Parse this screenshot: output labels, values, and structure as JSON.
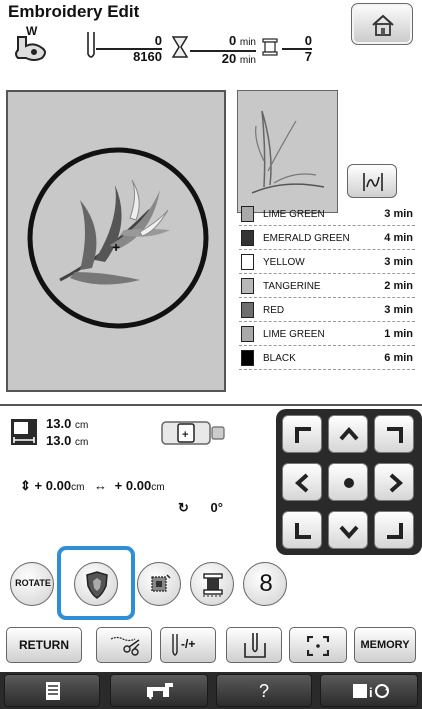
{
  "header": {
    "title": "Embroidery Edit",
    "home_icon": "home-icon",
    "presser_foot_label": "W",
    "stitch_counter": {
      "done": "0",
      "total": "8160"
    },
    "time_counter": {
      "done": "0",
      "done_unit": "min",
      "total": "20",
      "total_unit": "min"
    },
    "color_counter": {
      "done": "0",
      "total": "7"
    }
  },
  "preview": {
    "jump_icon": "needle-jump-icon"
  },
  "colors": [
    {
      "name": "LIME GREEN",
      "time": "3 min",
      "chip": "#a9a9a9"
    },
    {
      "name": "EMERALD GREEN",
      "time": "4 min",
      "chip": "#333333"
    },
    {
      "name": "YELLOW",
      "time": "3 min",
      "chip": "#ffffff"
    },
    {
      "name": "TANGERINE",
      "time": "2 min",
      "chip": "#b8b8b8"
    },
    {
      "name": "RED",
      "time": "3 min",
      "chip": "#6e6e6e"
    },
    {
      "name": "LIME GREEN",
      "time": "1 min",
      "chip": "#a9a9a9"
    },
    {
      "name": "BLACK",
      "time": "6 min",
      "chip": "#000000"
    }
  ],
  "size": {
    "width": "13.0",
    "height": "13.0",
    "unit": "cm"
  },
  "position": {
    "y_sign": "+",
    "y": "0.00",
    "y_unit": "cm",
    "x_sign": "+",
    "x": "0.00",
    "x_unit": "cm",
    "angle": "0°"
  },
  "tools": {
    "rotate_label": "ROTATE",
    "number_label": "8"
  },
  "bottom_buttons": {
    "return_label": "RETURN",
    "memory_label": "MEMORY",
    "density_label": "-/+"
  },
  "bottom_bar": {
    "help_label": "?"
  },
  "accent_color": "#2f8fd6"
}
